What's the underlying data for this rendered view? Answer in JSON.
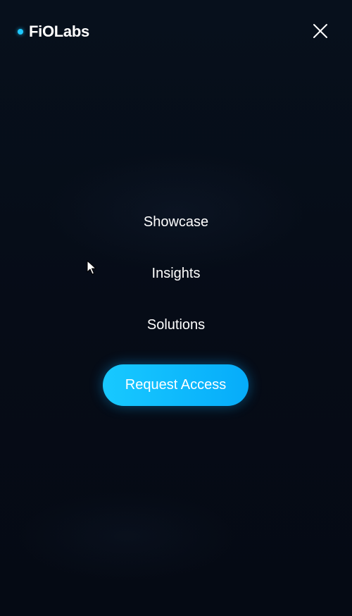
{
  "brand": {
    "name": "FiOLabs",
    "accent_color": "#1ec8ff"
  },
  "header": {
    "close_icon": "close-icon"
  },
  "menu": {
    "items": [
      {
        "label": "Showcase"
      },
      {
        "label": "Insights"
      },
      {
        "label": "Solutions"
      }
    ],
    "cta_label": "Request Access",
    "cta_gradient": [
      "#18c9ff",
      "#06acfa"
    ]
  },
  "background_color": "#070d18"
}
